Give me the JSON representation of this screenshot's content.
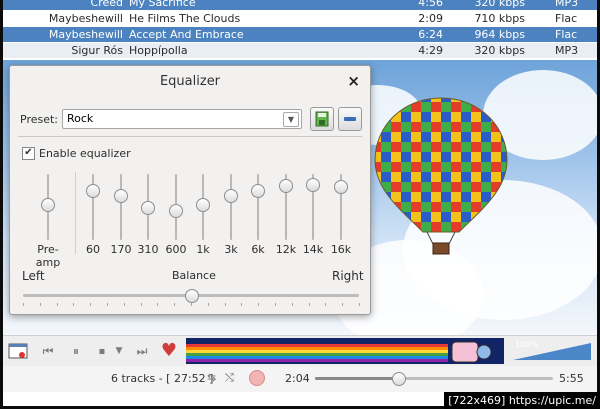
{
  "tracks": [
    {
      "artist": "Creed",
      "title": "My Sacrifice",
      "length": "4:56",
      "bitrate": "320 kbps",
      "format": "MP3",
      "state": "selected"
    },
    {
      "artist": "Maybeshewill",
      "title": "He Films The Clouds",
      "length": "2:09",
      "bitrate": "710 kbps",
      "format": "Flac",
      "state": "normal"
    },
    {
      "artist": "Maybeshewill",
      "title": "Accept And Embrace",
      "length": "6:24",
      "bitrate": "964 kbps",
      "format": "Flac",
      "state": "selected"
    },
    {
      "artist": "Sigur Rós",
      "title": "Hoppípolla",
      "length": "4:29",
      "bitrate": "320 kbps",
      "format": "MP3",
      "state": "normal"
    }
  ],
  "equalizer": {
    "title": "Equalizer",
    "close_symbol": "×",
    "preset_label": "Preset:",
    "preset_value": "Rock",
    "enable_label": "Enable equalizer",
    "enabled": true,
    "preamp_label": "Pre-amp",
    "preamp_level": 0.55,
    "bands": [
      {
        "label": "60",
        "level": 0.82
      },
      {
        "label": "170",
        "level": 0.72
      },
      {
        "label": "310",
        "level": 0.5
      },
      {
        "label": "600",
        "level": 0.45
      },
      {
        "label": "1k",
        "level": 0.55
      },
      {
        "label": "3k",
        "level": 0.72
      },
      {
        "label": "6k",
        "level": 0.82
      },
      {
        "label": "12k",
        "level": 0.9
      },
      {
        "label": "14k",
        "level": 0.92
      },
      {
        "label": "16k",
        "level": 0.88
      }
    ],
    "balance_label": "Balance",
    "balance_left": "Left",
    "balance_right": "Right",
    "balance_value": 0.5
  },
  "player": {
    "track_count": "6 tracks - [ 27:52 ]",
    "elapsed": "2:04",
    "total": "5:55",
    "progress": 0.35,
    "volume_label": "100%",
    "volume_level": 1.0
  },
  "watermark": "[722x469] https://upic.me/",
  "colors": {
    "selection": "#4c82bf",
    "analyzer_bg": "#102466",
    "heart": "#d23b3b"
  }
}
